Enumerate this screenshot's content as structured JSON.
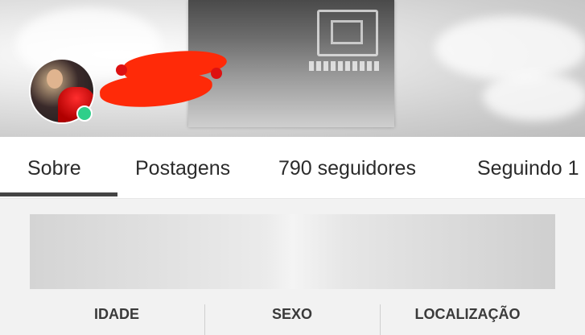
{
  "profile": {
    "status_color": "#2fcf8a"
  },
  "tabs": {
    "items": [
      {
        "label": "Sobre"
      },
      {
        "label": "Postagens"
      },
      {
        "label": "790 seguidores"
      },
      {
        "label": "Seguindo 1"
      }
    ],
    "active": "Sobre"
  },
  "about": {
    "fields": [
      {
        "label": "IDADE"
      },
      {
        "label": "SEXO"
      },
      {
        "label": "LOCALIZAÇÃO"
      }
    ]
  },
  "colors": {
    "redaction": "#ff2a08",
    "tab_indicator": "#444444"
  }
}
